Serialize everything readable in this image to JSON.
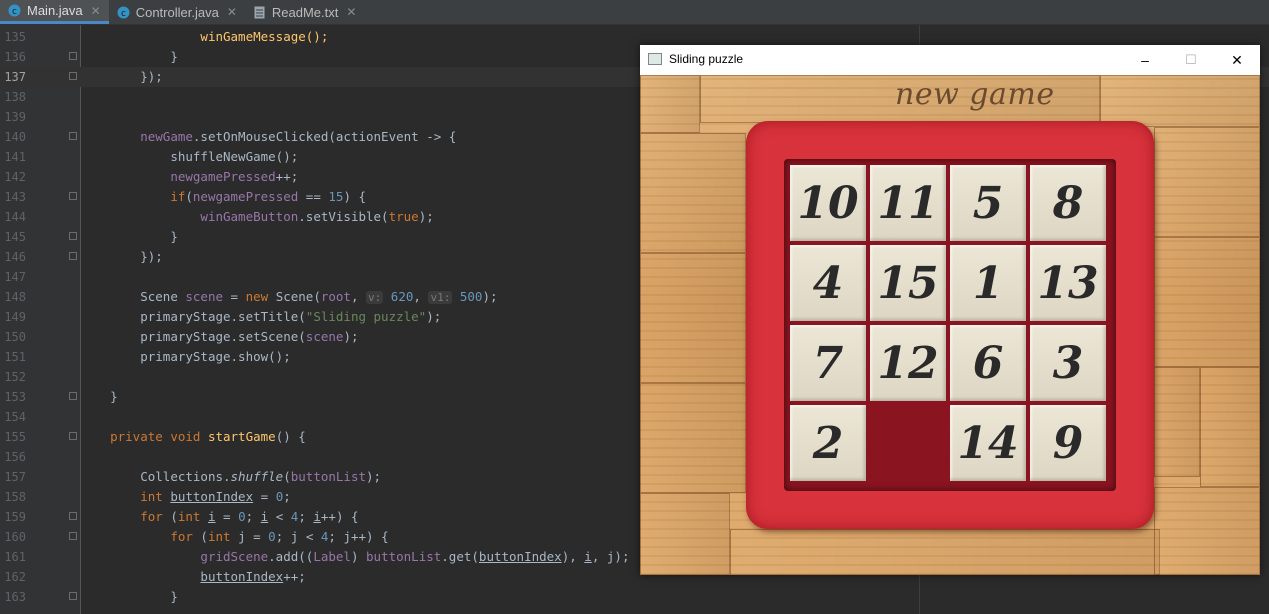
{
  "tabs": [
    {
      "label": "Main.java",
      "icon": "java-class-icon",
      "active": true
    },
    {
      "label": "Controller.java",
      "icon": "java-class-icon",
      "active": false
    },
    {
      "label": "ReadMe.txt",
      "icon": "text-file-icon",
      "active": false
    }
  ],
  "editor": {
    "line_numbers": [
      "135",
      "136",
      "137",
      "138",
      "139",
      "140",
      "141",
      "142",
      "143",
      "144",
      "145",
      "146",
      "147",
      "148",
      "149",
      "150",
      "151",
      "152",
      "153",
      "154",
      "155",
      "156",
      "157",
      "158",
      "159",
      "160",
      "161",
      "162",
      "163"
    ],
    "current_line": "137",
    "t": {
      "l135": "winGameMessage();",
      "l136": "}",
      "l137": "});",
      "l140a": "newGame",
      "l140b": ".setOnMouseClicked(actionEvent -> {",
      "l141": "shuffleNewGame();",
      "l142a": "newgamePressed",
      "l142b": "++;",
      "l143a": "if",
      "l143b": "(",
      "l143c": "newgamePressed",
      "l143d": " == ",
      "l143e": "15",
      "l143f": ") {",
      "l144a": "winGameButton",
      "l144b": ".setVisible(",
      "l144c": "true",
      "l144d": ");",
      "l145": "}",
      "l146": "});",
      "l148a": "Scene ",
      "l148b": "scene",
      "l148c": " = ",
      "l148d": "new",
      "l148e": " Scene(",
      "l148f": "root",
      "l148g": ", ",
      "l148h": "v:",
      "l148i": " 620",
      "l148j": ", ",
      "l148k": "v1:",
      "l148l": " 500",
      "l148m": ");",
      "l149a": "primaryStage.setTitle(",
      "l149b": "\"Sliding puzzle\"",
      "l149c": ");",
      "l150a": "primaryStage.setScene(",
      "l150b": "scene",
      "l150c": ");",
      "l151": "primaryStage.show();",
      "l153": "}",
      "l155a": "private void ",
      "l155b": "startGame",
      "l155c": "() {",
      "l157a": "Collections.",
      "l157b": "shuffle",
      "l157c": "(",
      "l157d": "buttonList",
      "l157e": ");",
      "l158a": "int ",
      "l158b": "buttonIndex",
      "l158c": " = ",
      "l158d": "0",
      "l158e": ";",
      "l159a": "for ",
      "l159b": "(",
      "l159c": "int ",
      "l159d": "i",
      "l159e": " = ",
      "l159f": "0",
      "l159g": "; ",
      "l159h": "i",
      "l159i": " < ",
      "l159j": "4",
      "l159k": "; ",
      "l159l": "i",
      "l159m": "++) {",
      "l160a": "for ",
      "l160b": "(",
      "l160c": "int ",
      "l160d": "j",
      "l160e": " = ",
      "l160f": "0",
      "l160g": "; ",
      "l160h": "j",
      "l160i": " < ",
      "l160j": "4",
      "l160k": "; ",
      "l160l": "j",
      "l160m": "++) {",
      "l161a": "gridScene",
      "l161b": ".add((",
      "l161c": "Label",
      "l161d": ") ",
      "l161e": "buttonList",
      "l161f": ".get(",
      "l161g": "buttonIndex",
      "l161h": "), ",
      "l161i": "i",
      "l161j": ", ",
      "l161k": "j",
      "l161l": ");",
      "l162a": "buttonIndex",
      "l162b": "++;",
      "l163": "}"
    }
  },
  "app_window": {
    "title": "Sliding puzzle",
    "minimize_glyph": "–",
    "maximize_glyph": "☐",
    "close_glyph": "✕",
    "new_game_label": "new game",
    "tiles": [
      [
        "10",
        "11",
        "5",
        "8"
      ],
      [
        "4",
        "15",
        "1",
        "13"
      ],
      [
        "7",
        "12",
        "6",
        "3"
      ],
      [
        "2",
        "",
        "14",
        "9"
      ]
    ]
  },
  "colors": {
    "editor_bg": "#2b2b2b",
    "tray_red": "#d8323c",
    "wood": "#dcaa6e"
  }
}
